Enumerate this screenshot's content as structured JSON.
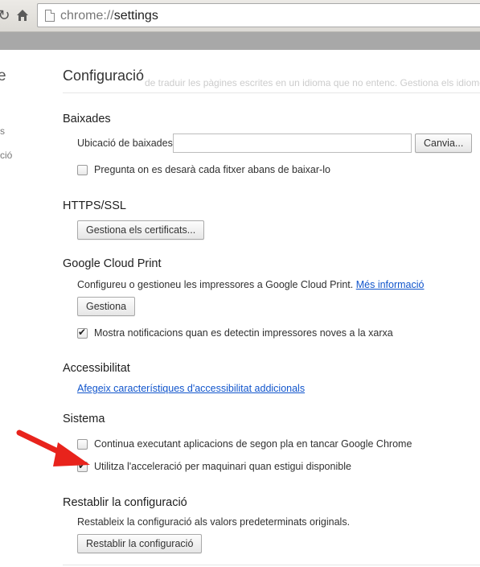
{
  "toolbar": {
    "url_scheme": "chrome://",
    "url_path": "settings"
  },
  "sidebar": {
    "title_fragment": "e",
    "items": [
      "s",
      "ció"
    ]
  },
  "header": {
    "title": "Configuració",
    "ghost_text": "de traduir les pàgines escrites en un idioma que no entenc. Gestiona els idiomes"
  },
  "downloads": {
    "heading": "Baixades",
    "location_label": "Ubicació de baixades:",
    "location_value": "",
    "change_button": "Canvia...",
    "ask_label": "Pregunta on es desarà cada fitxer abans de baixar-lo",
    "ask_checked": false
  },
  "https": {
    "heading": "HTTPS/SSL",
    "certs_button": "Gestiona els certificats..."
  },
  "cloud_print": {
    "heading": "Google Cloud Print",
    "description": "Configureu o gestioneu les impressores a Google Cloud Print.",
    "more_link": "Més informació",
    "manage_button": "Gestiona",
    "notify_label": "Mostra notificacions quan es detectin impressores noves a la xarxa",
    "notify_checked": true
  },
  "accessibility": {
    "heading": "Accessibilitat",
    "add_link": "Afegeix característiques d'accessibilitat addicionals"
  },
  "system": {
    "heading": "Sistema",
    "background_label": "Continua executant aplicacions de segon pla en tancar Google Chrome",
    "background_checked": false,
    "hw_accel_label": "Utilitza l'acceleració per maquinari quan estigui disponible",
    "hw_accel_checked": true
  },
  "reset": {
    "heading": "Restablir la configuració",
    "description": "Restableix la configuració als valors predeterminats originals.",
    "reset_button": "Restablir la configuració"
  },
  "colors": {
    "link": "#1155cc",
    "annotation_arrow": "#e8231c"
  }
}
